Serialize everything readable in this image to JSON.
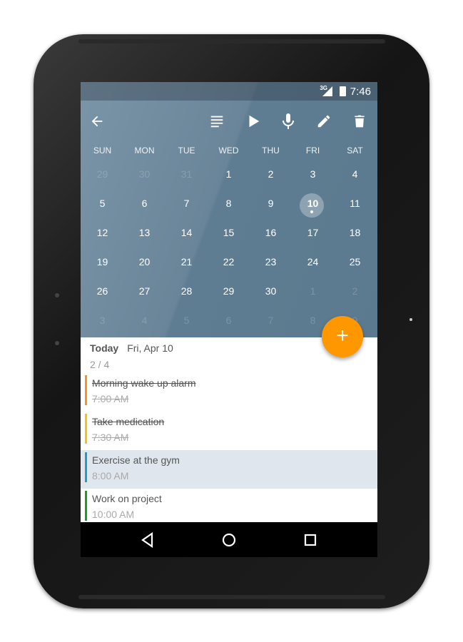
{
  "status": {
    "network": "3G",
    "time": "7:46"
  },
  "toolbar": {
    "icons": [
      "back-arrow-icon",
      "list-icon",
      "play-icon",
      "microphone-icon",
      "pencil-icon",
      "trash-icon"
    ]
  },
  "calendar": {
    "weekdays": [
      "SUN",
      "MON",
      "TUE",
      "WED",
      "THU",
      "FRI",
      "SAT"
    ],
    "weeks": [
      [
        "29",
        "30",
        "31",
        "1",
        "2",
        "3",
        "4"
      ],
      [
        "5",
        "6",
        "7",
        "8",
        "9",
        "10",
        "11"
      ],
      [
        "12",
        "13",
        "14",
        "15",
        "16",
        "17",
        "18"
      ],
      [
        "19",
        "20",
        "21",
        "22",
        "23",
        "24",
        "25"
      ],
      [
        "26",
        "27",
        "28",
        "29",
        "30",
        "1",
        "2"
      ],
      [
        "3",
        "4",
        "5",
        "6",
        "7",
        "8",
        "9"
      ]
    ],
    "selected": "10"
  },
  "fab": {
    "label": "+"
  },
  "agenda": {
    "today": "Today",
    "date": "Fri, Apr 10",
    "progress": "2 / 4",
    "items": [
      {
        "title": "Morning wake up alarm",
        "time": "7:00 AM",
        "done": true,
        "color": "#f7931e"
      },
      {
        "title": "Take medication",
        "time": "7:30 AM",
        "done": true,
        "color": "#f9c20c"
      },
      {
        "title": "Exercise at the gym",
        "time": "8:00 AM",
        "done": false,
        "color": "#1e9bd0",
        "highlighted": true
      },
      {
        "title": "Work on project",
        "time": "10:00 AM",
        "done": false,
        "color": "#19a022"
      }
    ]
  },
  "colors": {
    "calendar_bg": "#5f7d92",
    "accent": "#ff9800",
    "highlight": "#dfe6ed"
  }
}
